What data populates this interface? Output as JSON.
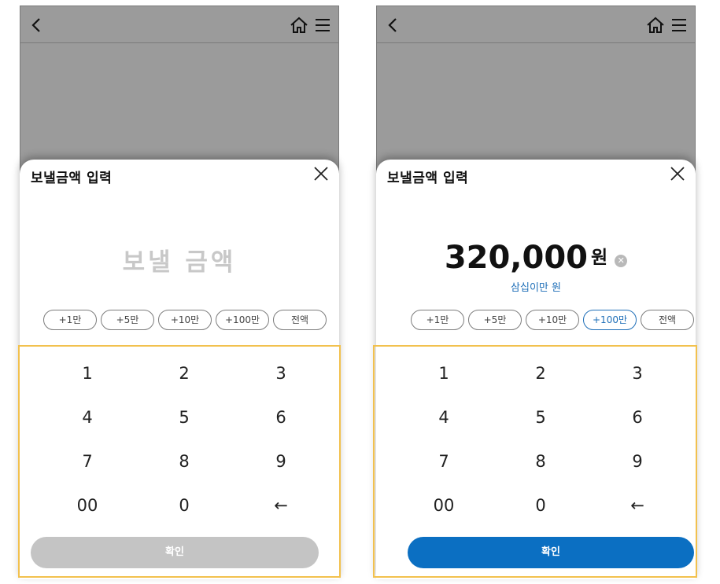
{
  "screens": [
    {
      "id": "empty",
      "sheet_title": "보낼금액 입력",
      "amount_placeholder": "보낼 금액",
      "quick_buttons": [
        "+1만",
        "+5만",
        "+10만",
        "+100만",
        "전액"
      ],
      "keypad": [
        "1",
        "2",
        "3",
        "4",
        "5",
        "6",
        "7",
        "8",
        "9",
        "00",
        "0",
        "←"
      ],
      "confirm_label": "확인",
      "confirm_color": "#c4c4c4"
    },
    {
      "id": "filled",
      "sheet_title": "보낼금액 입력",
      "amount_value": "320,000",
      "amount_unit": "원",
      "amount_words": "삼십이만 원",
      "quick_buttons": [
        "+1만",
        "+5만",
        "+10만",
        "+100만",
        "전액"
      ],
      "active_quick_button": "+100만",
      "keypad": [
        "1",
        "2",
        "3",
        "4",
        "5",
        "6",
        "7",
        "8",
        "9",
        "00",
        "0",
        "←"
      ],
      "confirm_label": "확인",
      "confirm_color": "#0b6fc2"
    }
  ],
  "colors": {
    "topbar_bg": "#9b9b9b",
    "accent": "#1f6fb8",
    "highlight_border": "#f2c14e"
  },
  "icons": [
    "back-arrow-icon",
    "home-icon",
    "hamburger-menu-icon",
    "close-icon",
    "clear-circle-icon"
  ]
}
